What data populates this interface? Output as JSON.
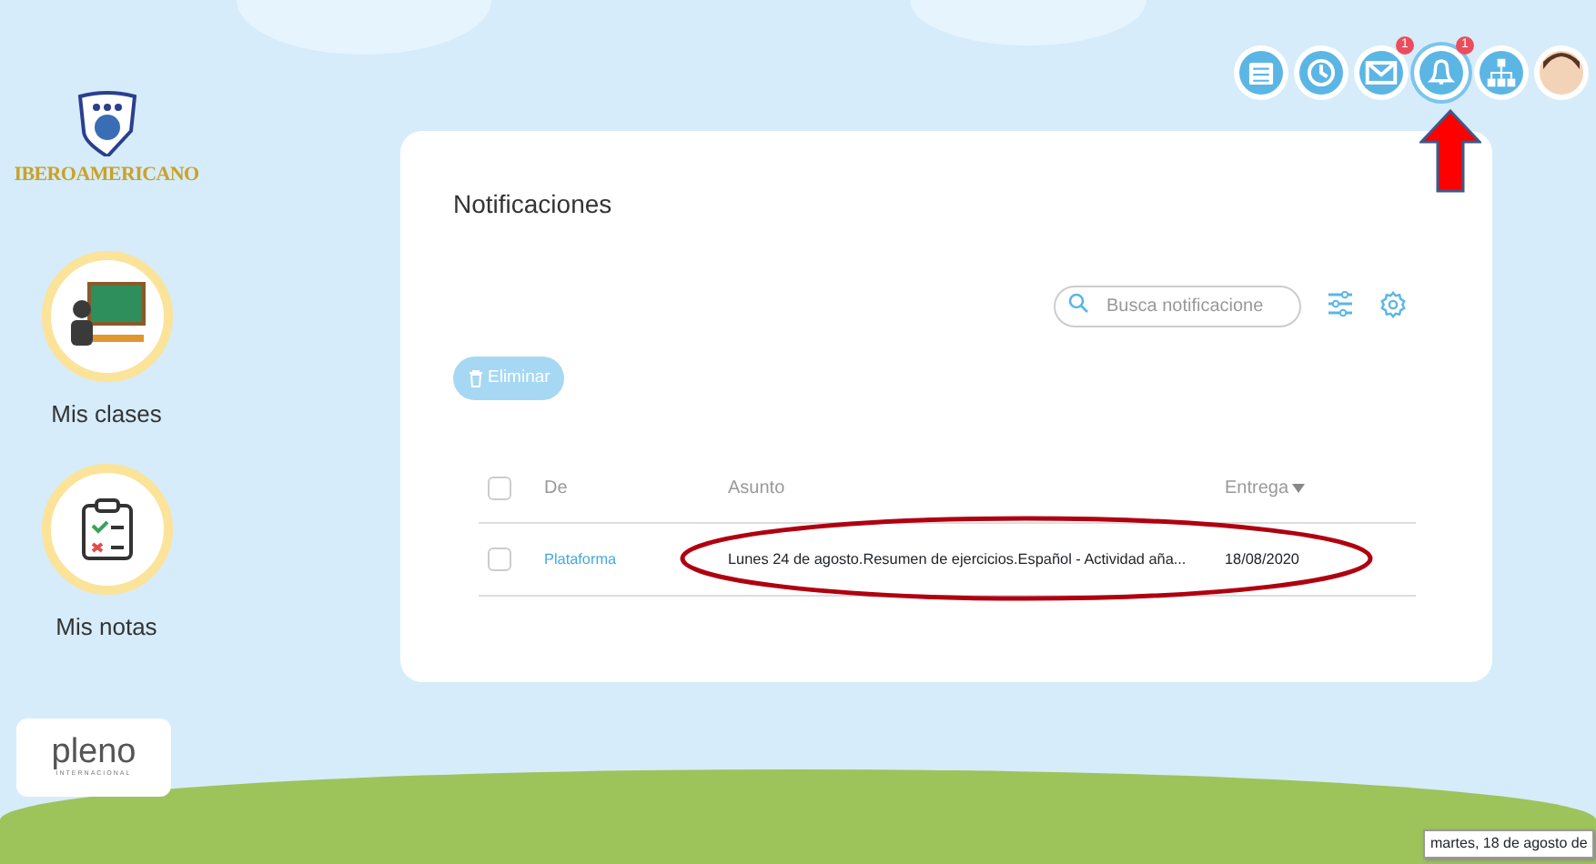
{
  "school_logo": {
    "name": "IBEROAMERICANO"
  },
  "header_icons": [
    {
      "kind": "calendar",
      "selected": false
    },
    {
      "kind": "clock",
      "selected": false
    },
    {
      "kind": "mail",
      "selected": false,
      "badge": "1"
    },
    {
      "kind": "bell",
      "selected": true,
      "badge": "1"
    },
    {
      "kind": "hierarchy",
      "selected": false
    },
    {
      "kind": "avatar",
      "selected": false
    }
  ],
  "sidebar": {
    "items": [
      {
        "kind": "classroom",
        "label": "Mis clases"
      },
      {
        "kind": "clipboard",
        "label": "Mis notas"
      }
    ]
  },
  "partner_logo": {
    "name": "pleno",
    "subtitle": "INTERNACIONAL"
  },
  "notifications": {
    "title": "Notificaciones",
    "search": {
      "placeholder": "Busca notificacione"
    },
    "delete_button": {
      "label": "Eliminar",
      "disabled": true
    },
    "table": {
      "columns": [
        "De",
        "Asunto",
        "Entrega"
      ],
      "header_checked": false,
      "rows": [
        {
          "checked": false,
          "from": "Plataforma",
          "subject": "Lunes 24 de agosto.Resumen de ejercicios.Español - Actividad aña...",
          "due": "18/08/2020"
        }
      ]
    }
  },
  "tooltip": "martes, 18 de agosto de"
}
